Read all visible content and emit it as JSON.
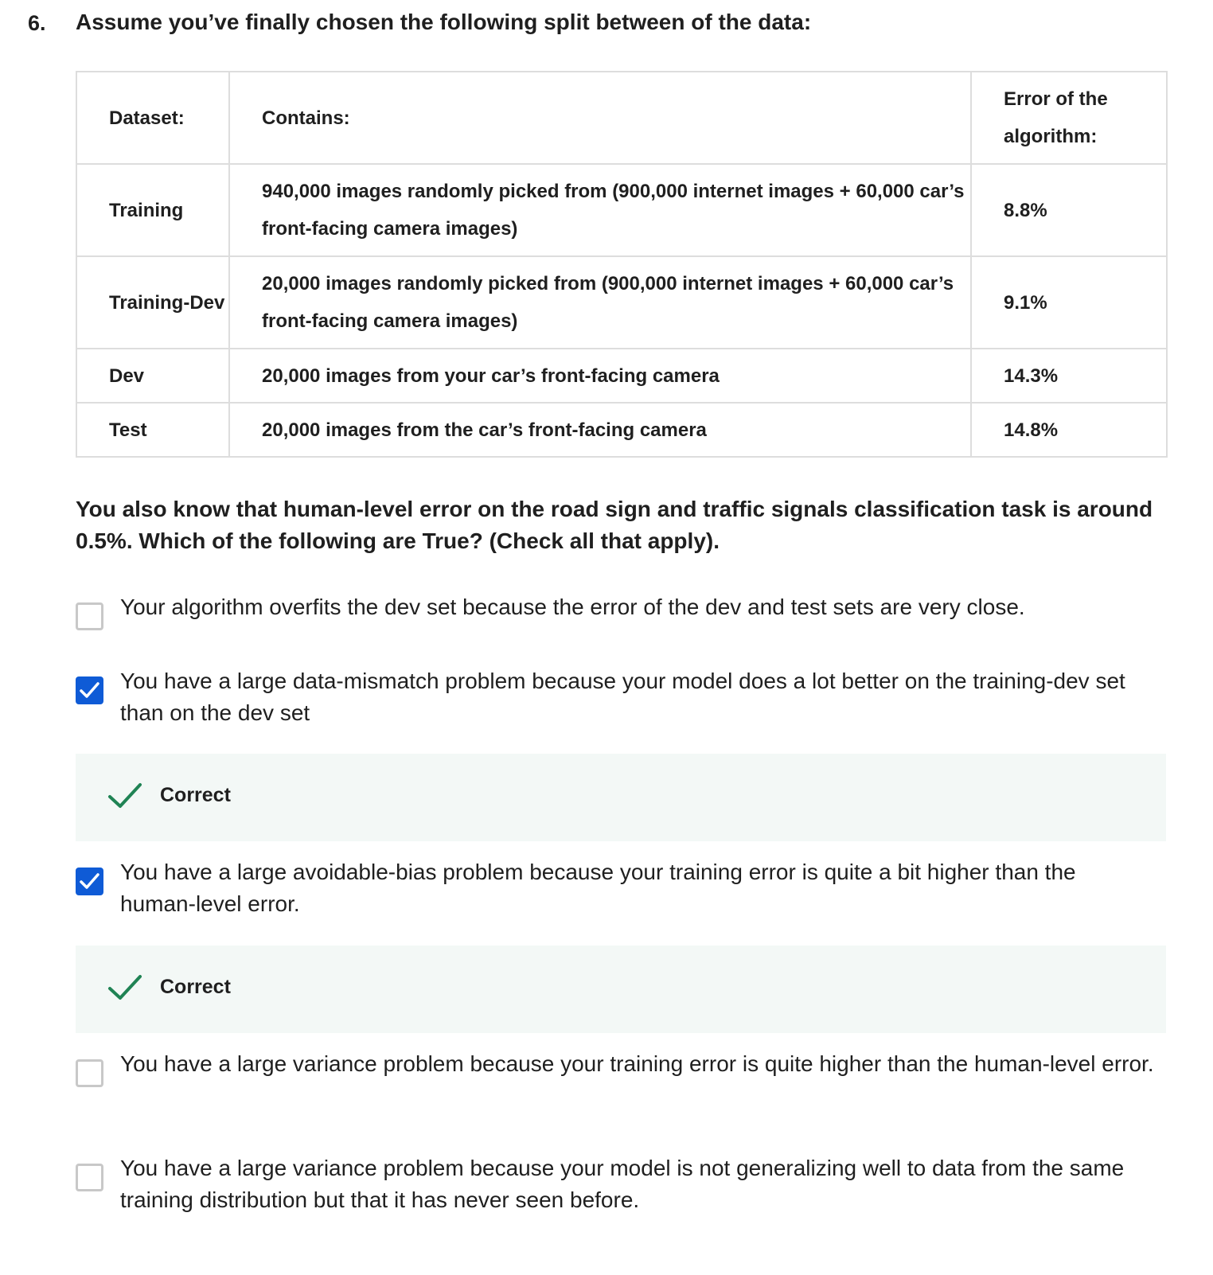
{
  "question": {
    "number": "6.",
    "title": "Assume you’ve finally chosen the following split between of the data:",
    "prompt": "You also know that human-level error on the road sign and traffic signals classification task is around 0.5%. Which of the following are True? (Check all that apply)."
  },
  "table": {
    "headers": [
      "Dataset:",
      "Contains:",
      "Error of the algorithm:"
    ],
    "rows": [
      {
        "dataset": "Training",
        "contains": "940,000 images randomly picked from (900,000 internet images + 60,000 car’s front-facing camera images)",
        "error": "8.8%"
      },
      {
        "dataset": "Training-Dev",
        "contains": "20,000 images randomly picked from (900,000 internet images + 60,000 car’s front-facing camera images)",
        "error": "9.1%"
      },
      {
        "dataset": "Dev",
        "contains": "20,000 images from your car’s front-facing camera",
        "error": "14.3%"
      },
      {
        "dataset": "Test",
        "contains": "20,000 images from the car’s front-facing camera",
        "error": "14.8%"
      }
    ]
  },
  "options": [
    {
      "text": "Your algorithm overfits the dev set because the error of the dev and test sets are very close.",
      "checked": false
    },
    {
      "text": "You have a large data-mismatch problem because your model does a lot better on the training-dev set than on the dev set",
      "checked": true,
      "feedback": "Correct"
    },
    {
      "text": "You have a large avoidable-bias problem because your training error is quite a bit higher than the human-level error.",
      "checked": true,
      "feedback": "Correct"
    },
    {
      "text": "You have a large variance problem because your training error is quite higher than the human-level error.",
      "checked": false
    },
    {
      "text": "You have a large variance problem because your model is not generalizing well to data from the same training distribution but that it has never seen before.",
      "checked": false
    }
  ],
  "colors": {
    "checkbox_checked": "#0f5bd6",
    "correct_check": "#1f8354",
    "feedback_bg": "#f3f8f6",
    "table_border": "#dddddd"
  }
}
